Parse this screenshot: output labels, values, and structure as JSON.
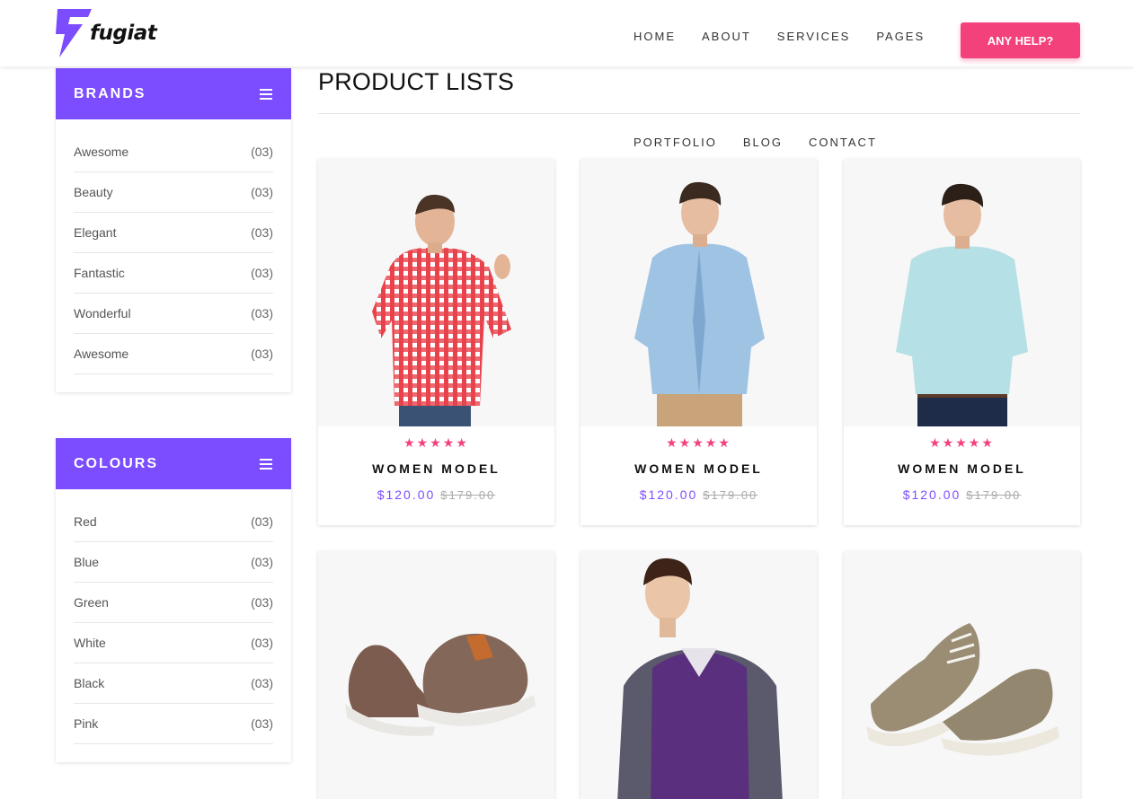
{
  "brand": {
    "name": "fugiat",
    "accent": "#7c4dff",
    "pink": "#f3417c"
  },
  "nav": {
    "items": [
      "HOME",
      "ABOUT",
      "SERVICES",
      "PAGES"
    ],
    "help_label": "ANY HELP?"
  },
  "sidebar": {
    "brands": {
      "title": "BRANDS",
      "items": [
        {
          "label": "Awesome",
          "count": "(03)"
        },
        {
          "label": "Beauty",
          "count": "(03)"
        },
        {
          "label": "Elegant",
          "count": "(03)"
        },
        {
          "label": "Fantastic",
          "count": "(03)"
        },
        {
          "label": "Wonderful",
          "count": "(03)"
        },
        {
          "label": "Awesome",
          "count": "(03)"
        }
      ]
    },
    "colours": {
      "title": "COLOURS",
      "items": [
        {
          "label": "Red",
          "count": "(03)"
        },
        {
          "label": "Blue",
          "count": "(03)"
        },
        {
          "label": "Green",
          "count": "(03)"
        },
        {
          "label": "White",
          "count": "(03)"
        },
        {
          "label": "Black",
          "count": "(03)"
        },
        {
          "label": "Pink",
          "count": "(03)"
        }
      ]
    }
  },
  "main": {
    "title": "PRODUCT LISTS",
    "filters": [
      "PORTFOLIO",
      "BLOG",
      "CONTACT"
    ],
    "products": [
      {
        "image": "man-red-checkered-shirt",
        "rating": 5,
        "stars": "★★★★★",
        "name": "WOMEN MODEL",
        "price": "$120.00",
        "old_price": "$179.00"
      },
      {
        "image": "man-denim-shirt",
        "rating": 5,
        "stars": "★★★★★",
        "name": "WOMEN MODEL",
        "price": "$120.00",
        "old_price": "$179.00"
      },
      {
        "image": "man-light-blue-shirt",
        "rating": 5,
        "stars": "★★★★★",
        "name": "WOMEN MODEL",
        "price": "$120.00",
        "old_price": "$179.00"
      },
      {
        "image": "brown-sneakers"
      },
      {
        "image": "man-purple-sweater-vest"
      },
      {
        "image": "khaki-sneakers"
      }
    ]
  }
}
